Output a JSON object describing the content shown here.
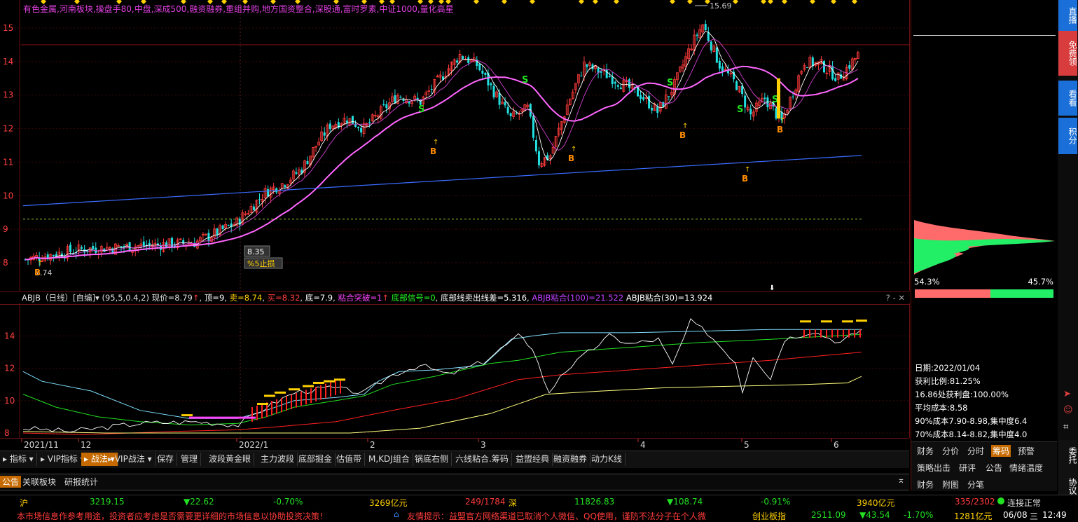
{
  "concept_tags": "有色金属,河南板块,操盘手80,中盘,深成500,融资融券,重组并购,地方国资整合,深股通,富时罗素,中证1000,量化高星",
  "main_chart": {
    "y_ticks": [
      "15",
      "14",
      "13",
      "12",
      "11",
      "10",
      "9",
      "8"
    ],
    "high_label": "15.69",
    "low_label": "7.74",
    "cursor_price": "8.35",
    "stop_loss_label": "%5止损",
    "signal_s": "S",
    "signal_b": "B"
  },
  "indicator": {
    "name": "ABJB（日线）[自编]",
    "params": "(95,5,0.4,2)",
    "current": "现价=8.79",
    "top": "顶=9",
    "sell": "卖=8.74",
    "buy": "买=8.32",
    "bottom": "底=7.9",
    "breakout": "粘合突破=1",
    "bottom_signal": "底部信号=0",
    "bottom_line": "底部线卖出线差=5.316",
    "abjb100": "ABJB粘合(100)=21.522",
    "abjb30": "ABJB粘合(30)=13.924",
    "y_ticks": [
      "14",
      "12",
      "10",
      "8"
    ],
    "controls": "? - ✕"
  },
  "xaxis": [
    "2021/11",
    "12",
    "2022/1",
    "2",
    "3",
    "4",
    "5",
    "6"
  ],
  "toolbar": [
    "指标",
    "VIP指标",
    "战法",
    "VIP战法",
    "保存",
    "管理",
    "波段黄金眼",
    "主力波段",
    "底部掘金",
    "估值带",
    "M,KDJ组合",
    "锅底右侧",
    "六线粘合.筹码",
    "益盟经典",
    "融资融券",
    "动力K线"
  ],
  "toolbar_active": "战法",
  "tabbar2": [
    "公告",
    "关联板块",
    "研报统计"
  ],
  "ticker": {
    "sh_label": "沪",
    "sh_value": "3219.15",
    "sh_change": "▼22.62",
    "sh_pct": "-0.70%",
    "sh_amount": "3269亿元",
    "sh_updown": "249/1784",
    "sz_label": "深",
    "sz_value": "11826.83",
    "sz_change": "▼108.74",
    "sz_pct": "-0.91%",
    "sz_amount": "3940亿元",
    "sz_updown": "335/2302",
    "status": "连接正常"
  },
  "news": {
    "left": "本市场信息作参考用途，投资者应考虑是否需要更详细的市场信息以协助投资决策！",
    "notice": "友情提示：益盟官方网络渠道已取消个人微信、QQ使用，谨防不法分子在个人微",
    "cy_label": "创业板指",
    "cy_value": "2511.09",
    "cy_change": "▼43.54",
    "cy_pct": "-1.70%",
    "cy_amount": "1281亿元",
    "date": "06/08",
    "weekday": "三",
    "time": "12:49"
  },
  "right_panel": {
    "profit_pct": "54.3%",
    "loss_pct": "45.7%",
    "date": "日期:2022/01/04",
    "profit_ratio": "获利比例:81.25%",
    "profit_at": "16.86处获利盘:100.00%",
    "avg_cost": "平均成本:8.58",
    "cost90": "90%成本7.90-8.98,集中度6.4",
    "cost70": "70%成本8.14-8.82,集中度4.0",
    "tabs_row1": [
      "财务",
      "分价",
      "分时",
      "筹码",
      "预警"
    ],
    "tabs_row2": [
      "策略出击",
      "研评",
      "公告",
      "情绪温度"
    ],
    "tabs_row3": [
      "财务",
      "附图",
      "分笔"
    ],
    "active_tab": "筹码"
  },
  "side_tabs": [
    "直播",
    "免费领",
    "看看",
    "积分",
    "委托",
    "协议"
  ],
  "colors": {
    "up": "#ff3b3b",
    "down": "#22e0e0",
    "ma_pink": "#ff66ff",
    "ma_blue": "#3a6cff",
    "accent": "#c66a00"
  }
}
